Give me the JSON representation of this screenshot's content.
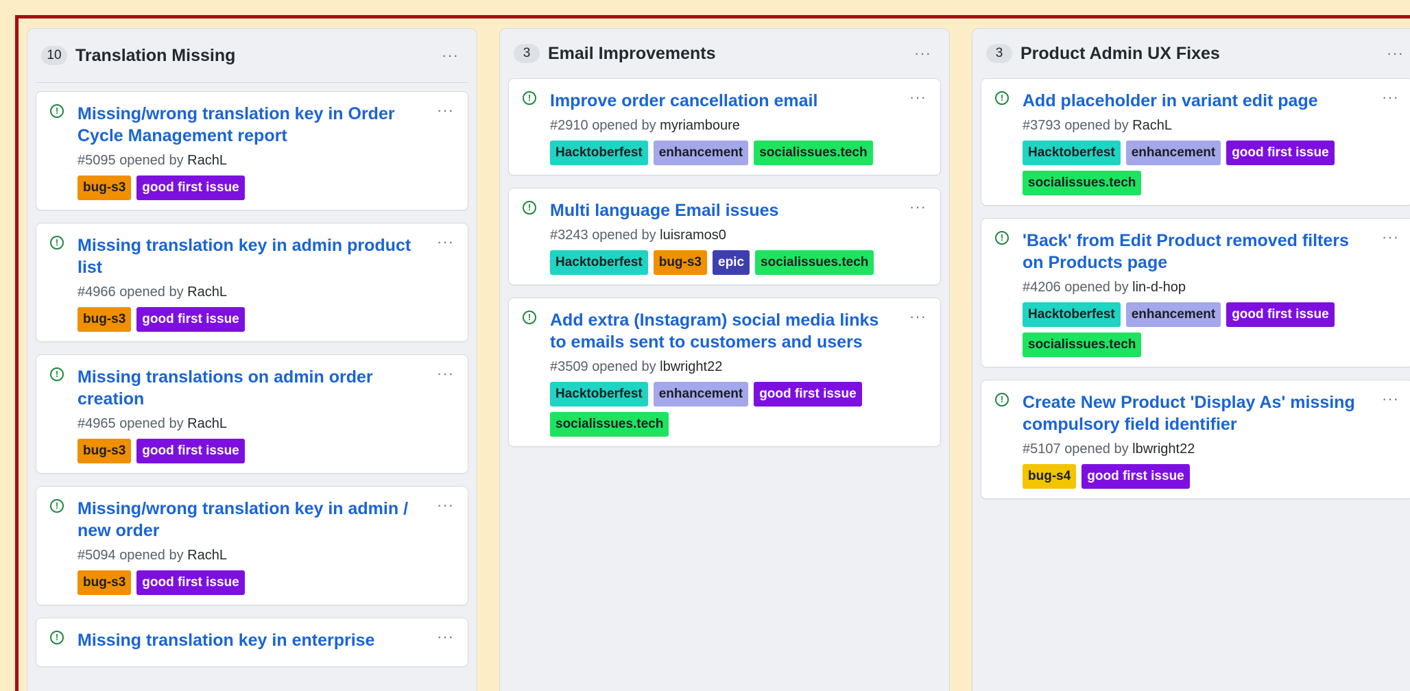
{
  "colors": {
    "background": "#fdedc7",
    "frame": "#a40f0f",
    "link": "#1a64d6",
    "open_icon": "#1f883d"
  },
  "icons": {
    "issue": "issue-opened-icon",
    "menu": "kebab-icon"
  },
  "columns": [
    {
      "count": "10",
      "title": "Translation Missing",
      "menu": "···",
      "cards": [
        {
          "title": "Missing/wrong translation key in Order Cycle Management report",
          "number": "#5095",
          "opened_by": "opened by",
          "author": "RachL",
          "labels": [
            {
              "text": "bug-s3",
              "cls": "l-bug3"
            },
            {
              "text": "good first issue",
              "cls": "l-gfi"
            }
          ]
        },
        {
          "title": "Missing translation key in admin product list",
          "number": "#4966",
          "opened_by": "opened by",
          "author": "RachL",
          "labels": [
            {
              "text": "bug-s3",
              "cls": "l-bug3"
            },
            {
              "text": "good first issue",
              "cls": "l-gfi"
            }
          ]
        },
        {
          "title": "Missing translations on admin order creation",
          "number": "#4965",
          "opened_by": "opened by",
          "author": "RachL",
          "labels": [
            {
              "text": "bug-s3",
              "cls": "l-bug3"
            },
            {
              "text": "good first issue",
              "cls": "l-gfi"
            }
          ]
        },
        {
          "title": "Missing/wrong translation key in admin / new order",
          "number": "#5094",
          "opened_by": "opened by",
          "author": "RachL",
          "labels": [
            {
              "text": "bug-s3",
              "cls": "l-bug3"
            },
            {
              "text": "good first issue",
              "cls": "l-gfi"
            }
          ]
        },
        {
          "title": "Missing translation key in enterprise",
          "number": "",
          "opened_by": "",
          "author": "",
          "labels": []
        }
      ]
    },
    {
      "count": "3",
      "title": "Email Improvements",
      "menu": "···",
      "cards": [
        {
          "title": "Improve order cancellation email",
          "number": "#2910",
          "opened_by": "opened by",
          "author": "myriamboure",
          "labels": [
            {
              "text": "Hacktoberfest",
              "cls": "l-hack"
            },
            {
              "text": "enhancement",
              "cls": "l-enh"
            },
            {
              "text": "socialissues.tech",
              "cls": "l-social"
            }
          ]
        },
        {
          "title": "Multi language Email issues",
          "number": "#3243",
          "opened_by": "opened by",
          "author": "luisramos0",
          "labels": [
            {
              "text": "Hacktoberfest",
              "cls": "l-hack"
            },
            {
              "text": "bug-s3",
              "cls": "l-bug3"
            },
            {
              "text": "epic",
              "cls": "l-epic"
            },
            {
              "text": "socialissues.tech",
              "cls": "l-social"
            }
          ]
        },
        {
          "title": "Add extra (Instagram) social media links to emails sent to customers and users",
          "number": "#3509",
          "opened_by": "opened by",
          "author": "lbwright22",
          "labels": [
            {
              "text": "Hacktoberfest",
              "cls": "l-hack"
            },
            {
              "text": "enhancement",
              "cls": "l-enh"
            },
            {
              "text": "good first issue",
              "cls": "l-gfi"
            },
            {
              "text": "socialissues.tech",
              "cls": "l-social"
            }
          ]
        }
      ]
    },
    {
      "count": "3",
      "title": "Product Admin UX Fixes",
      "menu": "···",
      "cards": [
        {
          "title": "Add placeholder in variant edit page",
          "number": "#3793",
          "opened_by": "opened by",
          "author": "RachL",
          "labels": [
            {
              "text": "Hacktoberfest",
              "cls": "l-hack"
            },
            {
              "text": "enhancement",
              "cls": "l-enh"
            },
            {
              "text": "good first issue",
              "cls": "l-gfi"
            },
            {
              "text": "socialissues.tech",
              "cls": "l-social"
            }
          ]
        },
        {
          "title": "'Back' from Edit Product removed filters on Products page",
          "number": "#4206",
          "opened_by": "opened by",
          "author": "lin-d-hop",
          "labels": [
            {
              "text": "Hacktoberfest",
              "cls": "l-hack"
            },
            {
              "text": "enhancement",
              "cls": "l-enh"
            },
            {
              "text": "good first issue",
              "cls": "l-gfi"
            },
            {
              "text": "socialissues.tech",
              "cls": "l-social"
            }
          ]
        },
        {
          "title": "Create New Product 'Display As' missing compulsory field identifier",
          "number": "#5107",
          "opened_by": "opened by",
          "author": "lbwright22",
          "labels": [
            {
              "text": "bug-s4",
              "cls": "l-bug4"
            },
            {
              "text": "good first issue",
              "cls": "l-gfi"
            }
          ]
        }
      ]
    }
  ]
}
